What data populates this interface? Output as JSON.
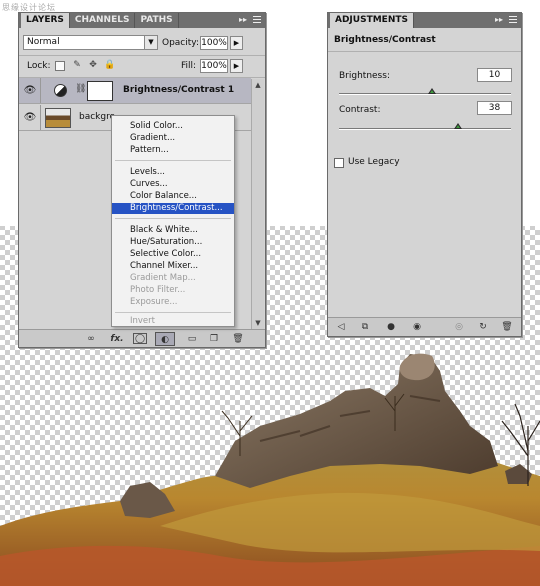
{
  "watermark": "思缘设计论坛",
  "layers_panel": {
    "tabs": [
      "LAYERS",
      "CHANNELS",
      "PATHS"
    ],
    "blend_mode": "Normal",
    "opacity_label": "Opacity:",
    "opacity_value": "100%",
    "lock_label": "Lock:",
    "fill_label": "Fill:",
    "fill_value": "100%",
    "layers": [
      {
        "name": "Brightness/Contrast 1",
        "selected": true
      },
      {
        "name": "backgro",
        "selected": false
      }
    ]
  },
  "context_menu": {
    "items": [
      {
        "label": "Solid Color...",
        "state": "enabled"
      },
      {
        "label": "Gradient...",
        "state": "enabled"
      },
      {
        "label": "Pattern...",
        "state": "enabled"
      },
      {
        "label": "Levels...",
        "state": "enabled"
      },
      {
        "label": "Curves...",
        "state": "enabled"
      },
      {
        "label": "Color Balance...",
        "state": "enabled"
      },
      {
        "label": "Brightness/Contrast...",
        "state": "highlighted"
      },
      {
        "label": "Black & White...",
        "state": "enabled"
      },
      {
        "label": "Hue/Saturation...",
        "state": "enabled"
      },
      {
        "label": "Selective Color...",
        "state": "enabled"
      },
      {
        "label": "Channel Mixer...",
        "state": "enabled"
      },
      {
        "label": "Gradient Map...",
        "state": "disabled"
      },
      {
        "label": "Photo Filter...",
        "state": "disabled"
      },
      {
        "label": "Exposure...",
        "state": "disabled"
      },
      {
        "label": "Invert",
        "state": "disabled"
      }
    ]
  },
  "adjustments_panel": {
    "tab": "ADJUSTMENTS",
    "heading": "Brightness/Contrast",
    "brightness_label": "Brightness:",
    "brightness_value": "10",
    "brightness_fraction": 0.54,
    "contrast_label": "Contrast:",
    "contrast_value": "38",
    "contrast_fraction": 0.69,
    "legacy_label": "Use Legacy",
    "legacy_checked": false
  },
  "colors": {
    "highlight": "#2653c4",
    "panel_bg": "#d4d4d4",
    "titlebar": "#6f6f6f"
  },
  "icons": [
    "eye-icon",
    "link-icon",
    "fx-icon",
    "mask-icon",
    "adjustment-layer-icon",
    "group-folder-icon",
    "new-layer-icon",
    "trash-icon",
    "lock-pixels-icon",
    "brush-icon",
    "move-icon",
    "lock-icon",
    "back-arrow-icon",
    "view-previous-icon",
    "clip-icon",
    "visibility-eye-icon",
    "reset-icon",
    "undo-icon"
  ]
}
